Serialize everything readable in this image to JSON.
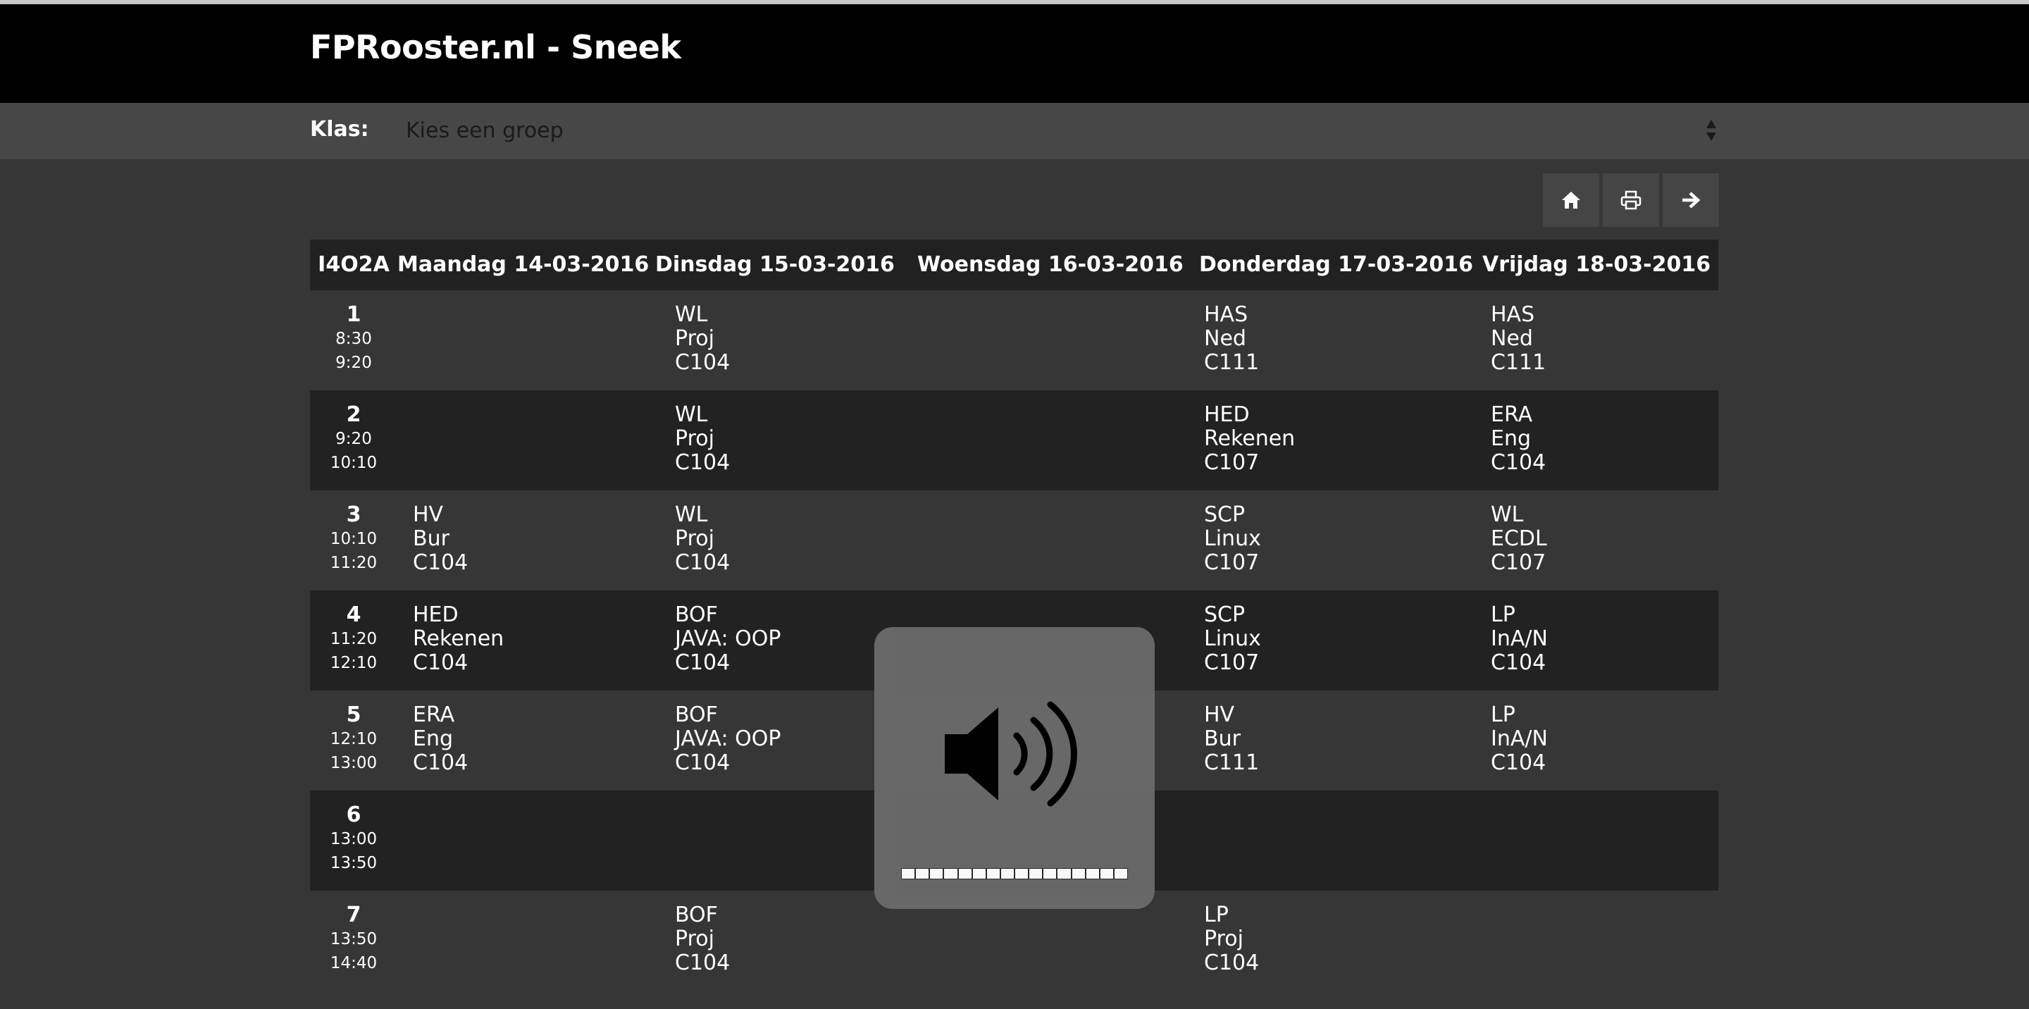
{
  "header": {
    "title": "FPRooster.nl - Sneek"
  },
  "klas": {
    "label": "Klas:",
    "select_value": "Kies een groep"
  },
  "toolbar": {
    "buttons": [
      "home-icon",
      "print-icon",
      "arrow-right-icon"
    ]
  },
  "timetable": {
    "group": "I4O2A",
    "days": [
      "Maandag 14-03-2016",
      "Dinsdag 15-03-2016",
      "Woensdag 16-03-2016",
      "Donderdag 17-03-2016",
      "Vrijdag 18-03-2016"
    ],
    "rows": [
      {
        "hour": "1",
        "start": "8:30",
        "end": "9:20",
        "cells": [
          {
            "t": "",
            "s": "",
            "r": ""
          },
          {
            "t": "WL",
            "s": "Proj",
            "r": "C104"
          },
          {
            "t": "",
            "s": "",
            "r": ""
          },
          {
            "t": "HAS",
            "s": "Ned",
            "r": "C111"
          },
          {
            "t": "HAS",
            "s": "Ned",
            "r": "C111"
          }
        ]
      },
      {
        "hour": "2",
        "start": "9:20",
        "end": "10:10",
        "cells": [
          {
            "t": "",
            "s": "",
            "r": ""
          },
          {
            "t": "WL",
            "s": "Proj",
            "r": "C104"
          },
          {
            "t": "",
            "s": "",
            "r": ""
          },
          {
            "t": "HED",
            "s": "Rekenen",
            "r": "C107"
          },
          {
            "t": "ERA",
            "s": "Eng",
            "r": "C104"
          }
        ]
      },
      {
        "hour": "3",
        "start": "10:10",
        "end": "11:20",
        "cells": [
          {
            "t": "HV",
            "s": "Bur",
            "r": "C104"
          },
          {
            "t": "WL",
            "s": "Proj",
            "r": "C104"
          },
          {
            "t": "",
            "s": "",
            "r": ""
          },
          {
            "t": "SCP",
            "s": "Linux",
            "r": "C107"
          },
          {
            "t": "WL",
            "s": "ECDL",
            "r": "C107"
          }
        ]
      },
      {
        "hour": "4",
        "start": "11:20",
        "end": "12:10",
        "cells": [
          {
            "t": "HED",
            "s": "Rekenen",
            "r": "C104"
          },
          {
            "t": "BOF",
            "s": "JAVA: OOP",
            "r": "C104"
          },
          {
            "t": "",
            "s": "",
            "r": ""
          },
          {
            "t": "SCP",
            "s": "Linux",
            "r": "C107"
          },
          {
            "t": "LP",
            "s": "InA/N",
            "r": "C104"
          }
        ]
      },
      {
        "hour": "5",
        "start": "12:10",
        "end": "13:00",
        "cells": [
          {
            "t": "ERA",
            "s": "Eng",
            "r": "C104"
          },
          {
            "t": "BOF",
            "s": "JAVA: OOP",
            "r": "C104"
          },
          {
            "t": "",
            "s": "",
            "r": ""
          },
          {
            "t": "HV",
            "s": "Bur",
            "r": "C111"
          },
          {
            "t": "LP",
            "s": "InA/N",
            "r": "C104"
          }
        ]
      },
      {
        "hour": "6",
        "start": "13:00",
        "end": "13:50",
        "cells": [
          {
            "t": "",
            "s": "",
            "r": ""
          },
          {
            "t": "",
            "s": "",
            "r": ""
          },
          {
            "t": "",
            "s": "",
            "r": ""
          },
          {
            "t": "",
            "s": "",
            "r": ""
          },
          {
            "t": "",
            "s": "",
            "r": ""
          }
        ]
      },
      {
        "hour": "7",
        "start": "13:50",
        "end": "14:40",
        "cells": [
          {
            "t": "",
            "s": "",
            "r": ""
          },
          {
            "t": "BOF",
            "s": "Proj",
            "r": "C104"
          },
          {
            "t": "",
            "s": "",
            "r": ""
          },
          {
            "t": "LP",
            "s": "Proj",
            "r": "C104"
          },
          {
            "t": "",
            "s": "",
            "r": ""
          }
        ]
      }
    ]
  },
  "volume_hud": {
    "icon": "speaker-volume-icon",
    "level": 1.0,
    "segments": 16
  }
}
